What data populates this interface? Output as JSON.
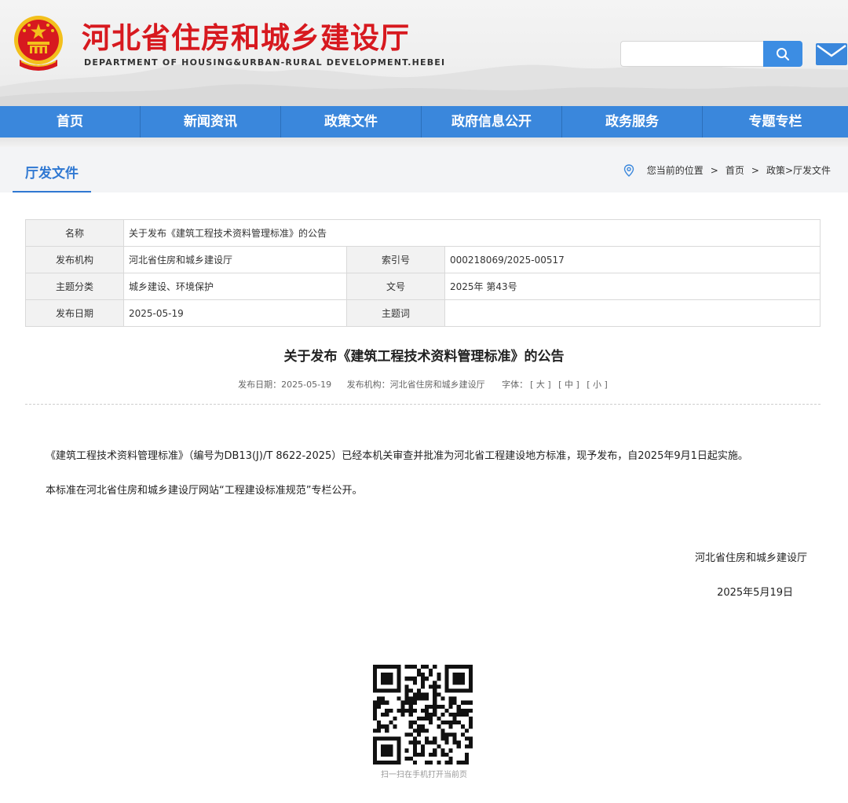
{
  "header": {
    "site_title": "河北省住房和城乡建设厅",
    "site_subtitle": "DEPARTMENT OF HOUSING&URBAN-RURAL DEVELOPMENT.HEBEI",
    "search_placeholder": "",
    "emblem_icon": "national-emblem-icon",
    "search_icon": "search-icon",
    "mail_icon": "mail-icon",
    "brand_red": "#d7191f",
    "accent_blue": "#3a87dc"
  },
  "nav": {
    "items": [
      "首页",
      "新闻资讯",
      "政策文件",
      "政府信息公开",
      "政务服务",
      "专题专栏"
    ]
  },
  "breadcrumb": {
    "section_title": "厅发文件",
    "location_label": "您当前的位置",
    "sep": ">",
    "home": "首页",
    "path": "政策>厅发文件",
    "pin_icon": "location-pin-icon"
  },
  "info_table": {
    "name_label": "名称",
    "name_value": "关于发布《建筑工程技术资料管理标准》的公告",
    "publisher_label": "发布机构",
    "publisher_value": "河北省住房和城乡建设厅",
    "index_label": "索引号",
    "index_value": "000218069/2025-00517",
    "topic_label": "主题分类",
    "topic_value": "城乡建设、环境保护",
    "docno_label": "文号",
    "docno_value": "2025年 第43号",
    "date_label": "发布日期",
    "date_value": "2025-05-19",
    "keyword_label": "主题词",
    "keyword_value": ""
  },
  "article": {
    "title": "关于发布《建筑工程技术资料管理标准》的公告",
    "meta_date": "发布日期：2025-05-19",
    "meta_org": "发布机构：河北省住房和城乡建设厅",
    "meta_font_label": "字体：",
    "font_large": "[ 大 ]",
    "font_medium": "[ 中 ]",
    "font_small": "[ 小 ]",
    "paragraph_1": "《建筑工程技术资料管理标准》（编号为DB13(J)/T 8622-2025）已经本机关审查并批准为河北省工程建设地方标准，现予发布，自2025年9月1日起实施。",
    "paragraph_2": "本标准在河北省住房和城乡建设厅网站“工程建设标准规范”专栏公开。",
    "signature_org": "河北省住房和城乡建设厅",
    "signature_date": "2025年5月19日"
  },
  "qr": {
    "caption": "扫一扫在手机打开当前页",
    "icon": "qr-code-icon"
  }
}
